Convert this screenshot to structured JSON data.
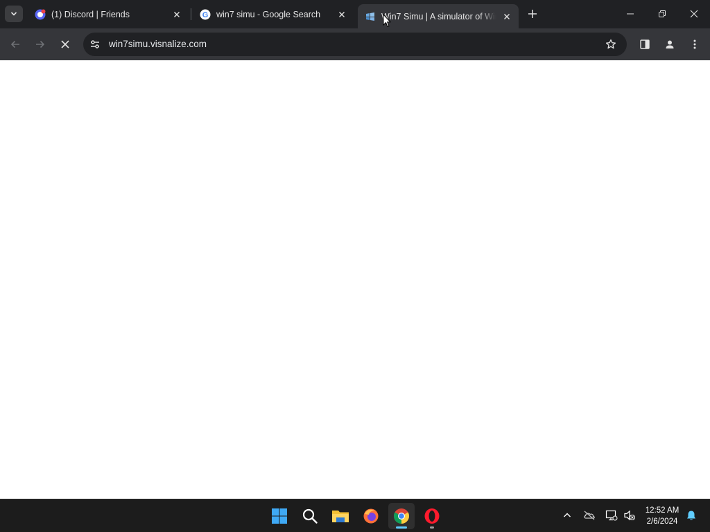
{
  "browser": {
    "tabs": [
      {
        "title": "(1) Discord | Friends",
        "favicon": "discord-icon",
        "active": false
      },
      {
        "title": "win7 simu - Google Search",
        "favicon": "google-icon",
        "active": false
      },
      {
        "title": "Win7 Simu | A simulator of Windows 7",
        "favicon": "win7simu-icon",
        "active": true
      }
    ],
    "address": "win7simu.visnalize.com",
    "colors": {
      "frame": "#202124",
      "toolbar": "#35363a",
      "omnibox": "#202124",
      "text": "#e3e3e3"
    }
  },
  "taskbar": {
    "apps": [
      {
        "name": "Start",
        "icon": "windows-start-icon"
      },
      {
        "name": "Search",
        "icon": "search-icon"
      },
      {
        "name": "File Explorer",
        "icon": "folder-icon"
      },
      {
        "name": "Firefox",
        "icon": "firefox-icon"
      },
      {
        "name": "Google Chrome",
        "icon": "chrome-icon",
        "active": true
      },
      {
        "name": "Opera",
        "icon": "opera-icon",
        "running": true
      }
    ],
    "clock": {
      "time": "12:52 AM",
      "date": "2/6/2024"
    },
    "tray_icons": [
      "chevron-up-icon",
      "onedrive-offline-icon",
      "network-icon",
      "volume-muted-icon",
      "notification-bell-icon"
    ]
  }
}
